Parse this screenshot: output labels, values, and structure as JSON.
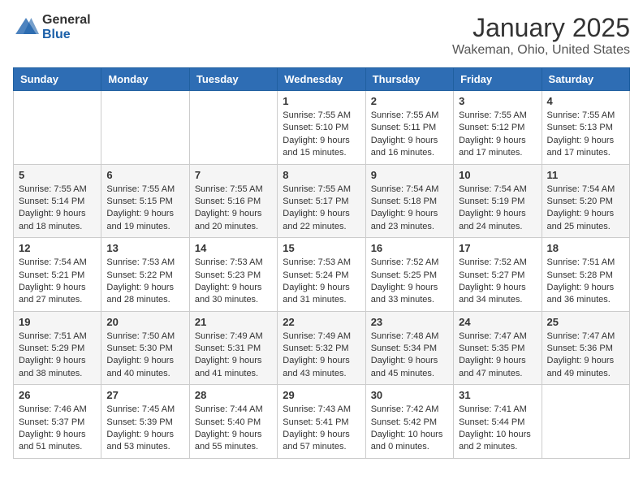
{
  "header": {
    "logo_general": "General",
    "logo_blue": "Blue",
    "month": "January 2025",
    "location": "Wakeman, Ohio, United States"
  },
  "days_of_week": [
    "Sunday",
    "Monday",
    "Tuesday",
    "Wednesday",
    "Thursday",
    "Friday",
    "Saturday"
  ],
  "weeks": [
    [
      {
        "day": "",
        "info": ""
      },
      {
        "day": "",
        "info": ""
      },
      {
        "day": "",
        "info": ""
      },
      {
        "day": "1",
        "info": "Sunrise: 7:55 AM\nSunset: 5:10 PM\nDaylight: 9 hours and 15 minutes."
      },
      {
        "day": "2",
        "info": "Sunrise: 7:55 AM\nSunset: 5:11 PM\nDaylight: 9 hours and 16 minutes."
      },
      {
        "day": "3",
        "info": "Sunrise: 7:55 AM\nSunset: 5:12 PM\nDaylight: 9 hours and 17 minutes."
      },
      {
        "day": "4",
        "info": "Sunrise: 7:55 AM\nSunset: 5:13 PM\nDaylight: 9 hours and 17 minutes."
      }
    ],
    [
      {
        "day": "5",
        "info": "Sunrise: 7:55 AM\nSunset: 5:14 PM\nDaylight: 9 hours and 18 minutes."
      },
      {
        "day": "6",
        "info": "Sunrise: 7:55 AM\nSunset: 5:15 PM\nDaylight: 9 hours and 19 minutes."
      },
      {
        "day": "7",
        "info": "Sunrise: 7:55 AM\nSunset: 5:16 PM\nDaylight: 9 hours and 20 minutes."
      },
      {
        "day": "8",
        "info": "Sunrise: 7:55 AM\nSunset: 5:17 PM\nDaylight: 9 hours and 22 minutes."
      },
      {
        "day": "9",
        "info": "Sunrise: 7:54 AM\nSunset: 5:18 PM\nDaylight: 9 hours and 23 minutes."
      },
      {
        "day": "10",
        "info": "Sunrise: 7:54 AM\nSunset: 5:19 PM\nDaylight: 9 hours and 24 minutes."
      },
      {
        "day": "11",
        "info": "Sunrise: 7:54 AM\nSunset: 5:20 PM\nDaylight: 9 hours and 25 minutes."
      }
    ],
    [
      {
        "day": "12",
        "info": "Sunrise: 7:54 AM\nSunset: 5:21 PM\nDaylight: 9 hours and 27 minutes."
      },
      {
        "day": "13",
        "info": "Sunrise: 7:53 AM\nSunset: 5:22 PM\nDaylight: 9 hours and 28 minutes."
      },
      {
        "day": "14",
        "info": "Sunrise: 7:53 AM\nSunset: 5:23 PM\nDaylight: 9 hours and 30 minutes."
      },
      {
        "day": "15",
        "info": "Sunrise: 7:53 AM\nSunset: 5:24 PM\nDaylight: 9 hours and 31 minutes."
      },
      {
        "day": "16",
        "info": "Sunrise: 7:52 AM\nSunset: 5:25 PM\nDaylight: 9 hours and 33 minutes."
      },
      {
        "day": "17",
        "info": "Sunrise: 7:52 AM\nSunset: 5:27 PM\nDaylight: 9 hours and 34 minutes."
      },
      {
        "day": "18",
        "info": "Sunrise: 7:51 AM\nSunset: 5:28 PM\nDaylight: 9 hours and 36 minutes."
      }
    ],
    [
      {
        "day": "19",
        "info": "Sunrise: 7:51 AM\nSunset: 5:29 PM\nDaylight: 9 hours and 38 minutes."
      },
      {
        "day": "20",
        "info": "Sunrise: 7:50 AM\nSunset: 5:30 PM\nDaylight: 9 hours and 40 minutes."
      },
      {
        "day": "21",
        "info": "Sunrise: 7:49 AM\nSunset: 5:31 PM\nDaylight: 9 hours and 41 minutes."
      },
      {
        "day": "22",
        "info": "Sunrise: 7:49 AM\nSunset: 5:32 PM\nDaylight: 9 hours and 43 minutes."
      },
      {
        "day": "23",
        "info": "Sunrise: 7:48 AM\nSunset: 5:34 PM\nDaylight: 9 hours and 45 minutes."
      },
      {
        "day": "24",
        "info": "Sunrise: 7:47 AM\nSunset: 5:35 PM\nDaylight: 9 hours and 47 minutes."
      },
      {
        "day": "25",
        "info": "Sunrise: 7:47 AM\nSunset: 5:36 PM\nDaylight: 9 hours and 49 minutes."
      }
    ],
    [
      {
        "day": "26",
        "info": "Sunrise: 7:46 AM\nSunset: 5:37 PM\nDaylight: 9 hours and 51 minutes."
      },
      {
        "day": "27",
        "info": "Sunrise: 7:45 AM\nSunset: 5:39 PM\nDaylight: 9 hours and 53 minutes."
      },
      {
        "day": "28",
        "info": "Sunrise: 7:44 AM\nSunset: 5:40 PM\nDaylight: 9 hours and 55 minutes."
      },
      {
        "day": "29",
        "info": "Sunrise: 7:43 AM\nSunset: 5:41 PM\nDaylight: 9 hours and 57 minutes."
      },
      {
        "day": "30",
        "info": "Sunrise: 7:42 AM\nSunset: 5:42 PM\nDaylight: 10 hours and 0 minutes."
      },
      {
        "day": "31",
        "info": "Sunrise: 7:41 AM\nSunset: 5:44 PM\nDaylight: 10 hours and 2 minutes."
      },
      {
        "day": "",
        "info": ""
      }
    ]
  ]
}
